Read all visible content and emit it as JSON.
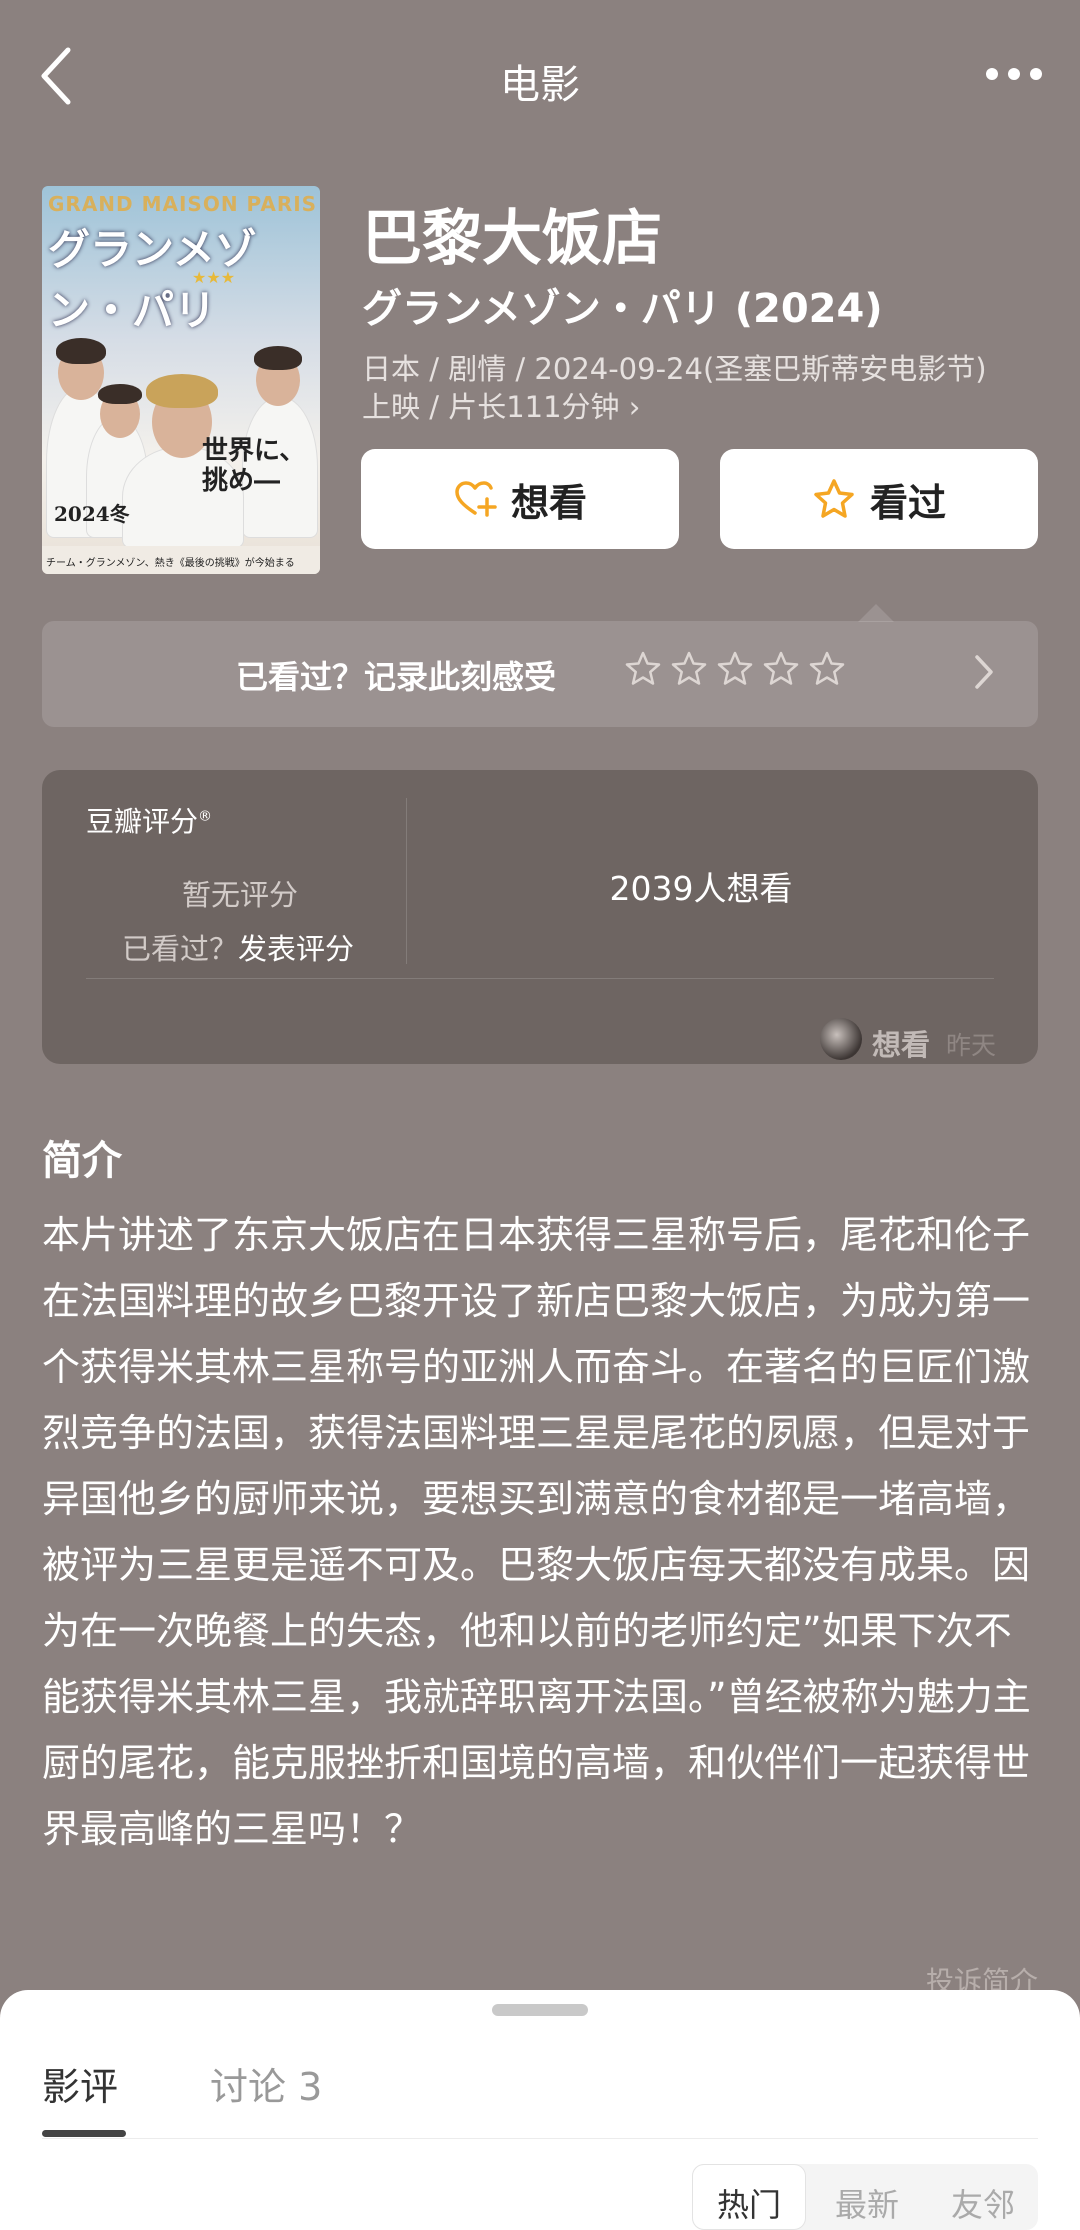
{
  "header": {
    "title": "电影"
  },
  "movie": {
    "title": "巴黎大饭店",
    "original_title": "グランメゾン・パリ (2024)",
    "meta_line1": "日本 / 剧情 / 2024-09-24(圣塞巴斯蒂安电影节)",
    "meta_line2": "上映 / 片长111分钟 ›",
    "poster": {
      "top_text": "GRAND MAISON PARIS",
      "title_text": "グランメゾン・パリ",
      "tagline_line1": "世界に、",
      "tagline_line2": "挑め―",
      "year_text": "2024冬",
      "bottom_text": "チーム・グランメゾン、熱き《最後の挑戦》が今始まる"
    }
  },
  "actions": {
    "want_label": "想看",
    "seen_label": "看过"
  },
  "rate_prompt": {
    "text": "已看过？记录此刻感受",
    "star_count": 5
  },
  "score": {
    "label": "豆瓣评分",
    "no_score": "暂无评分",
    "rate_prefix": "已看过？",
    "rate_link": "发表评分",
    "want_count": "2039人想看",
    "recent_action": "想看",
    "recent_time": "昨天"
  },
  "synopsis": {
    "title": "简介",
    "body": "本片讲述了东京大饭店在日本获得三星称号后，尾花和伦子在法国料理的故乡巴黎开设了新店巴黎大饭店，为成为第一个获得米其林三星称号的亚洲人而奋斗。在著名的巨匠们激烈竞争的法国，获得法国料理三星是尾花的夙愿，但是对于异国他乡的厨师来说，要想买到满意的食材都是一堵高墙，被评为三星更是遥不可及。巴黎大饭店每天都没有成果。因为在一次晚餐上的失态，他和以前的老师约定”如果下次不能获得米其林三星，我就辞职离开法国。”曾经被称为魅力主厨的尾花，能克服挫折和国境的高墙，和伙伴们一起获得世界最高峰的三星吗！？",
    "report": "投诉简介"
  },
  "sheet": {
    "tabs": [
      "影评",
      "讨论 3"
    ],
    "sort": [
      "热门",
      "最新",
      "友邻"
    ]
  },
  "colors": {
    "background": "#8b817f",
    "star": "#f5a623",
    "card": "#6e6562"
  }
}
